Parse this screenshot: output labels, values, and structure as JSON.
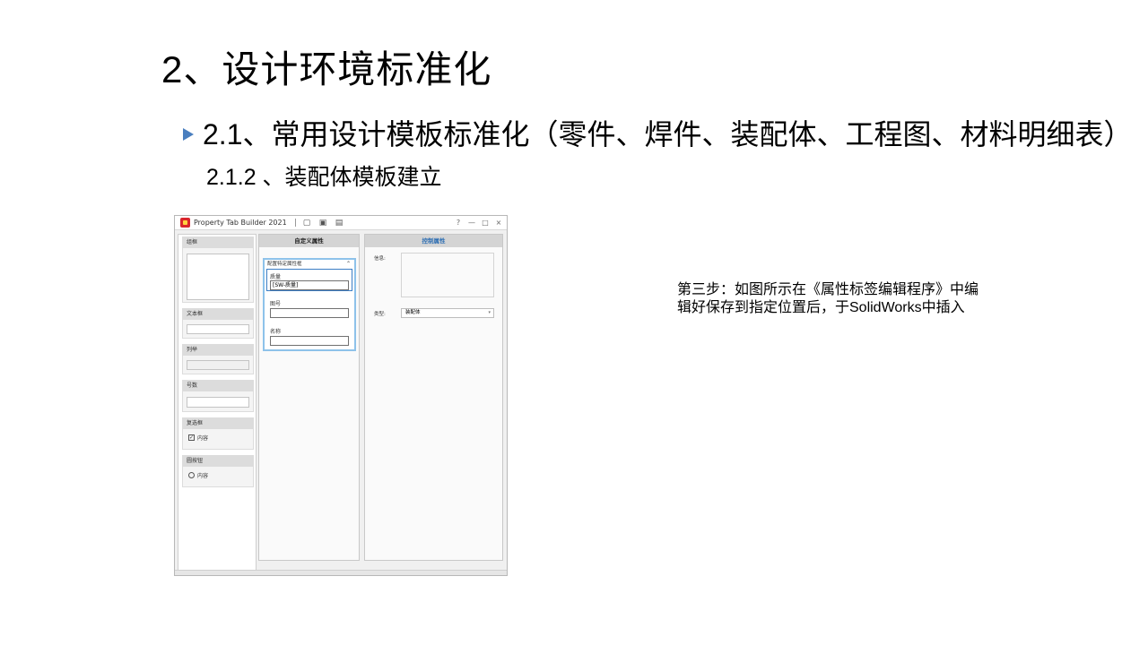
{
  "slide": {
    "title": "2、设计环境标准化",
    "bullet": "2.1、常用设计模板标准化（零件、焊件、装配体、工程图、材料明细表）",
    "subheading": "2.1.2 、装配体模板建立",
    "note": "第三步：如图所示在《属性标签编辑程序》中编辑好保存到指定位置后，于SolidWorks中插入"
  },
  "app": {
    "title": "Property Tab Builder 2021",
    "window_buttons": [
      "?",
      "—",
      "□",
      "×"
    ],
    "controls_palette": {
      "groupbox": "组框",
      "textbox": "文本框",
      "list": "列举",
      "number": "号数",
      "checkbox": "复选框",
      "checkbox_content": "内容",
      "radio": "圆按钮",
      "radio_content": "内容"
    },
    "middle": {
      "header": "自定义属性",
      "group_title": "配置特定属性框",
      "fields": [
        {
          "label": "质量",
          "value": "[SW-质量]"
        },
        {
          "label": "图号",
          "value": ""
        },
        {
          "label": "名称",
          "value": ""
        }
      ]
    },
    "right": {
      "header": "控制属性",
      "info_label": "信息:",
      "type_label": "类型:",
      "type_value": "装配体"
    }
  }
}
